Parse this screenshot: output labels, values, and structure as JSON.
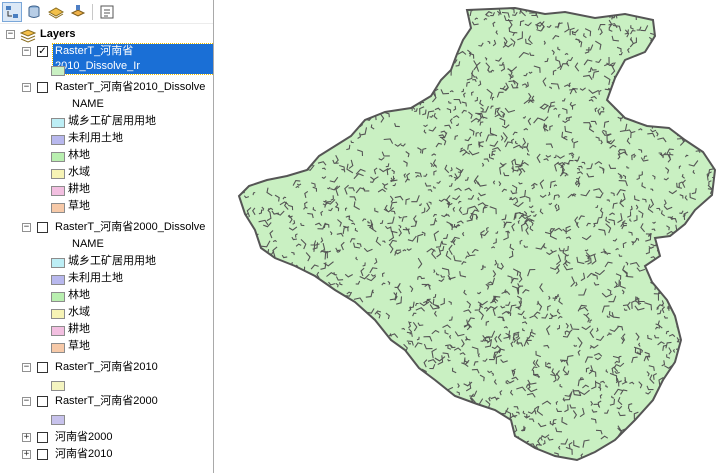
{
  "toolbar": {
    "buttons": [
      {
        "icon": "list-by-drawing-order-icon",
        "active": true
      },
      {
        "icon": "list-by-source-icon",
        "active": false
      },
      {
        "icon": "list-by-visibility-icon",
        "active": false
      },
      {
        "icon": "list-by-selection-icon",
        "active": false
      },
      {
        "icon": "options-icon",
        "active": false
      }
    ]
  },
  "toc": {
    "root_label": "Layers",
    "layer1": {
      "name": "RasterT_河南省2010_Dissolve_Ir",
      "checked": true,
      "expanded": true,
      "swatch_color": "#c9f0c2"
    },
    "layer2": {
      "name": "RasterT_河南省2010_Dissolve",
      "checked": false,
      "field": "NAME",
      "classes": [
        {
          "label": "城乡工矿居用用地",
          "color": "#bdeef5"
        },
        {
          "label": "未利用土地",
          "color": "#b8b8ee"
        },
        {
          "label": "林地",
          "color": "#b9efb0"
        },
        {
          "label": "水域",
          "color": "#f6f3b5"
        },
        {
          "label": "耕地",
          "color": "#f2bfe0"
        },
        {
          "label": "草地",
          "color": "#f6c9a8"
        }
      ]
    },
    "layer3": {
      "name": "RasterT_河南省2000_Dissolve",
      "checked": false,
      "field": "NAME",
      "classes": [
        {
          "label": "城乡工矿居用用地",
          "color": "#bdeef5"
        },
        {
          "label": "未利用土地",
          "color": "#b8b8ee"
        },
        {
          "label": "林地",
          "color": "#b9efb0"
        },
        {
          "label": "水域",
          "color": "#f6f3b5"
        },
        {
          "label": "耕地",
          "color": "#f2bfe0"
        },
        {
          "label": "草地",
          "color": "#f6c9a8"
        }
      ]
    },
    "layer4": {
      "name": "RasterT_河南省2010",
      "checked": false,
      "swatch_color": "#f4f4c0"
    },
    "layer5": {
      "name": "RasterT_河南省2000",
      "checked": false,
      "swatch_color": "#c7c2ec"
    },
    "layer6": {
      "name": "河南省2000",
      "checked": false,
      "expanded": false
    },
    "layer7": {
      "name": "河南省2010",
      "checked": false,
      "expanded": false
    }
  },
  "map": {
    "fill_color": "#c9f0c2",
    "boundary_color": "#555555"
  }
}
